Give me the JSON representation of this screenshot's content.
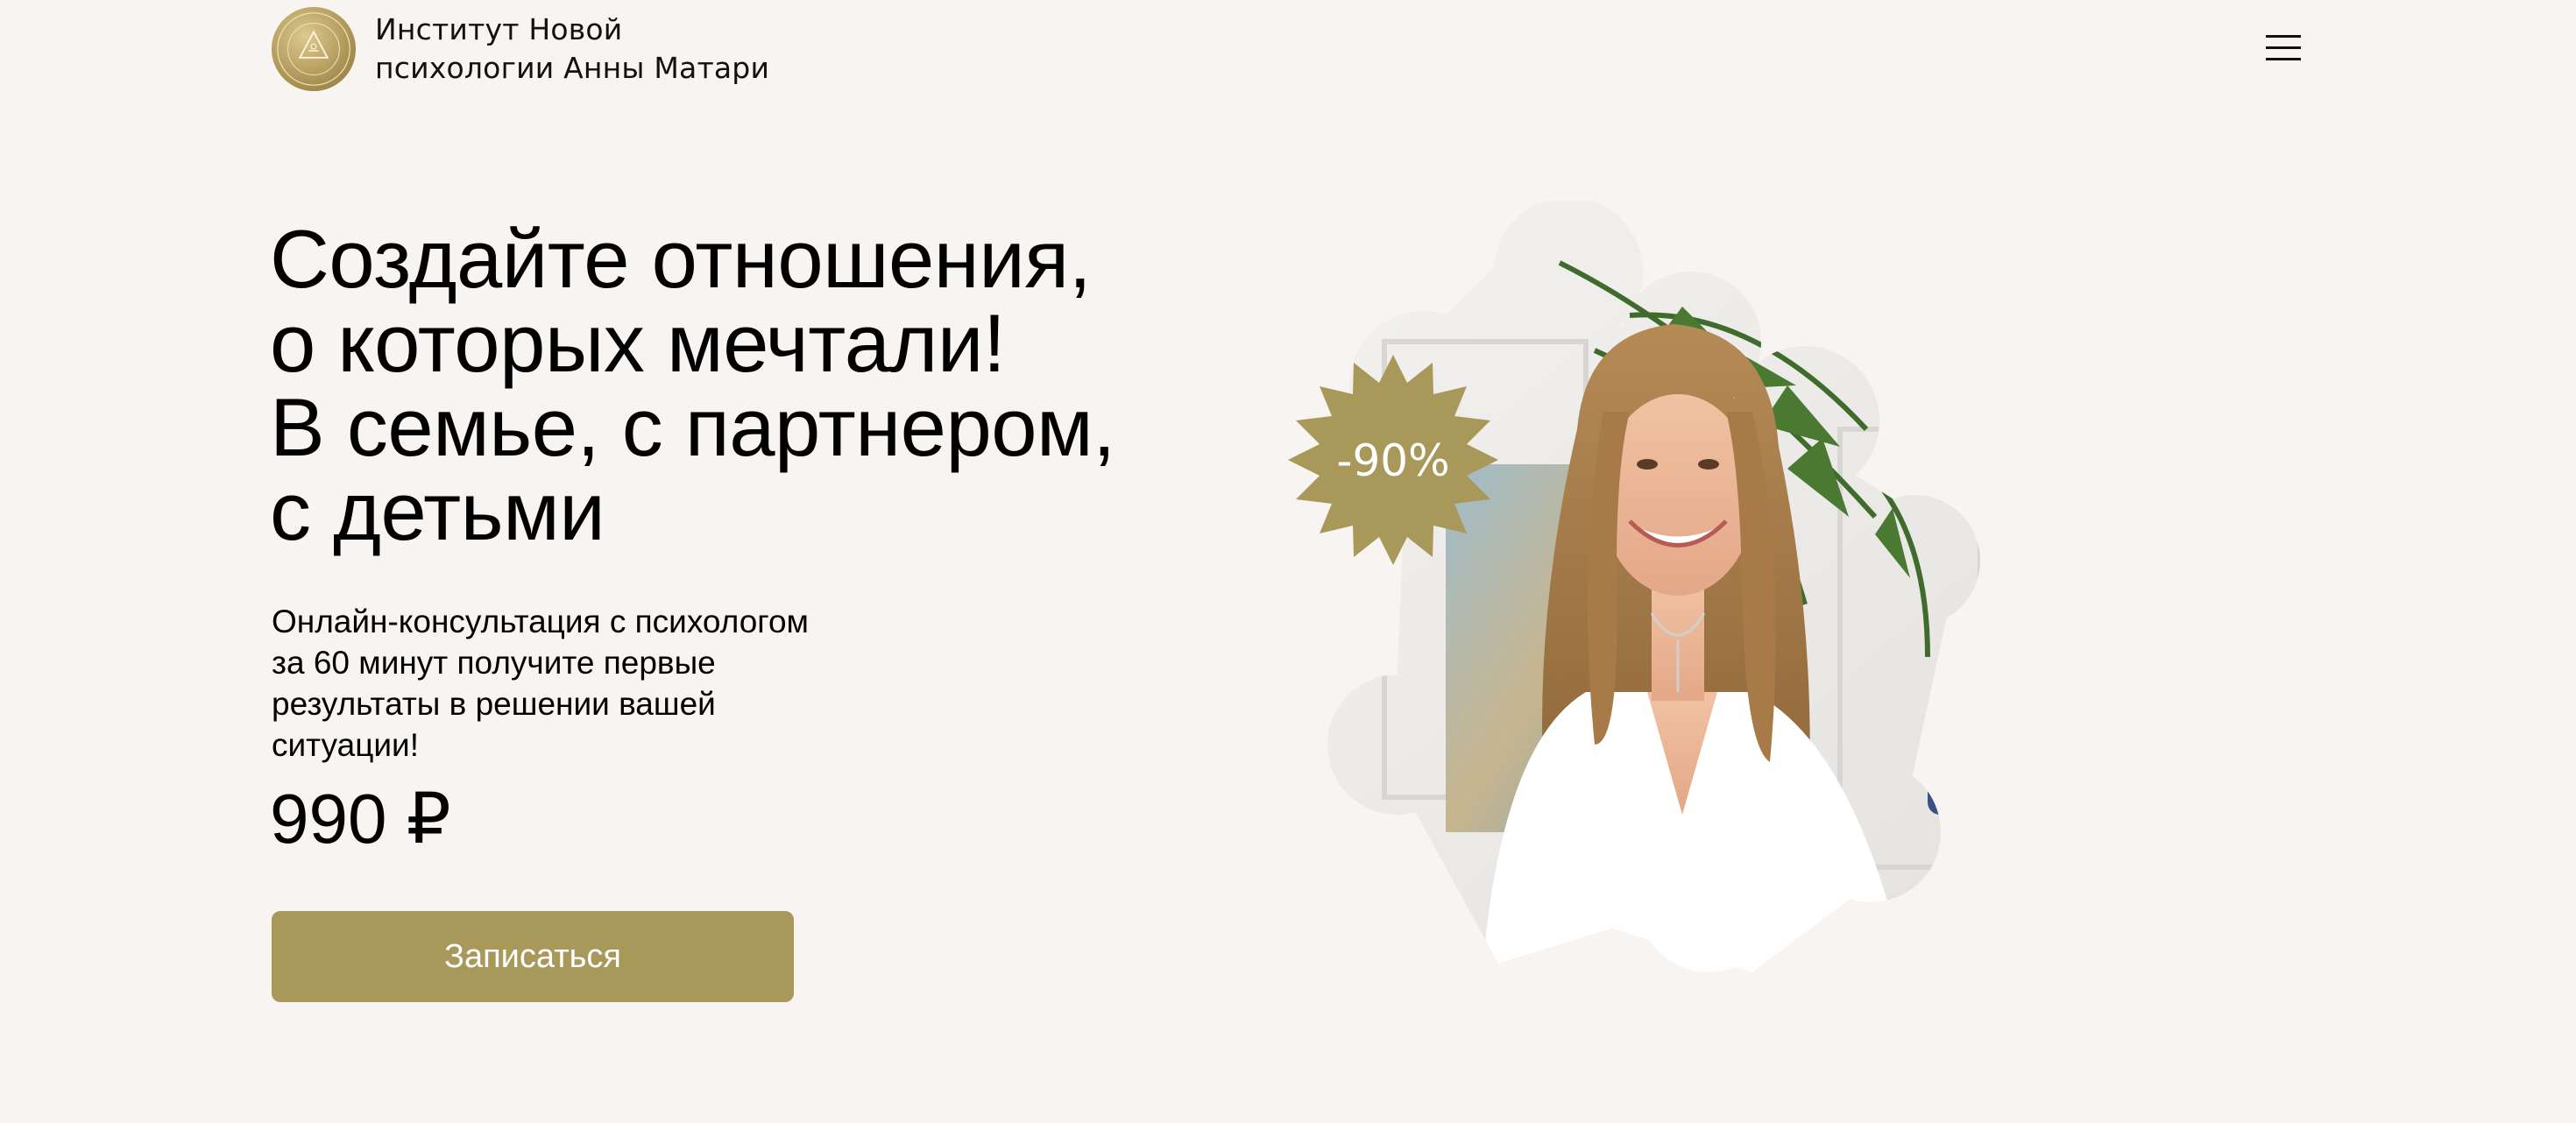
{
  "header": {
    "brand_line1": "Институт Новой",
    "brand_line2": "психологии Анны Матари",
    "logo_icon": "institute-seal",
    "menu_icon": "hamburger-icon"
  },
  "hero": {
    "headline_lines": [
      "Создайте отношения,",
      "о которых мечтали!",
      "В семье, с партнером,",
      "с детьми"
    ],
    "subtitle_lines": [
      "Онлайн-консультация с психологом",
      "за 60 минут получите первые",
      "результаты в решении вашей",
      "ситуации!"
    ],
    "price": "990 ₽",
    "cta_label": "Записаться",
    "discount_badge": "-90%"
  },
  "colors": {
    "background": "#f7f4f1",
    "accent": "#a8985a",
    "text": "#000000"
  }
}
